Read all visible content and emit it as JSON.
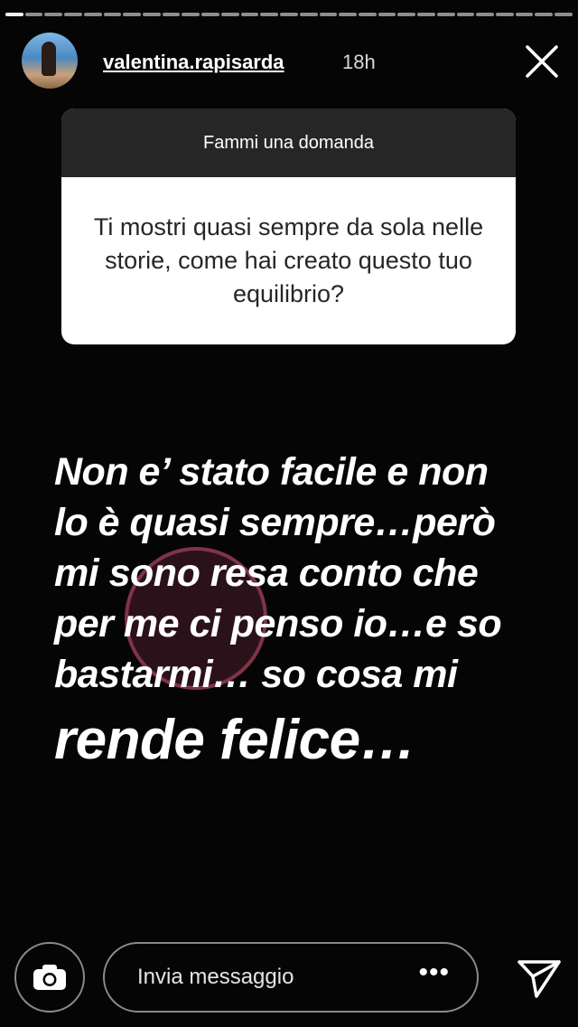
{
  "story": {
    "progress_segments": 29,
    "progress_current": 1
  },
  "header": {
    "username": "valentina.rapisarda",
    "time": "18h",
    "avatar_icon": "avatar-photo",
    "close_icon": "close-icon"
  },
  "question_sticker": {
    "title": "Fammi una domanda",
    "question": "Ti mostri quasi sempre da sola nelle storie, come hai creato questo tuo equilibrio?"
  },
  "answer": {
    "lines": [
      "Non e’ stato facile e non",
      "lo è quasi sempre…però",
      "mi sono resa conto che",
      "per me ci penso io…e so",
      "bastarmi… so cosa mi",
      "rende felice…"
    ]
  },
  "footer": {
    "camera_icon": "camera-icon",
    "message_placeholder": "Invia messaggio",
    "more_label": "•••",
    "send_icon": "send-icon"
  },
  "colors": {
    "background": "#050505",
    "sticker_header": "#262626",
    "sticker_body": "#ffffff",
    "text": "#ffffff"
  }
}
